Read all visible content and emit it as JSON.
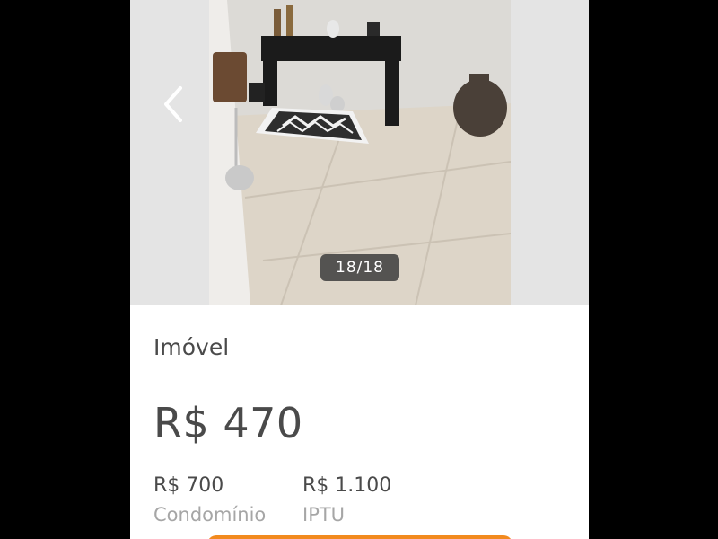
{
  "gallery": {
    "counter": "18/18",
    "prev_icon": "chevron-left-icon"
  },
  "listing": {
    "category": "Imóvel",
    "price": "R$ 470",
    "fees": [
      {
        "value": "R$ 700",
        "label": "Condomínio"
      },
      {
        "value": "R$ 1.100",
        "label": "IPTU"
      }
    ]
  },
  "colors": {
    "accent": "#f28a1e",
    "text": "#4a4a4a",
    "muted": "#a6a6a6",
    "counter_bg": "#3c3c3c"
  }
}
